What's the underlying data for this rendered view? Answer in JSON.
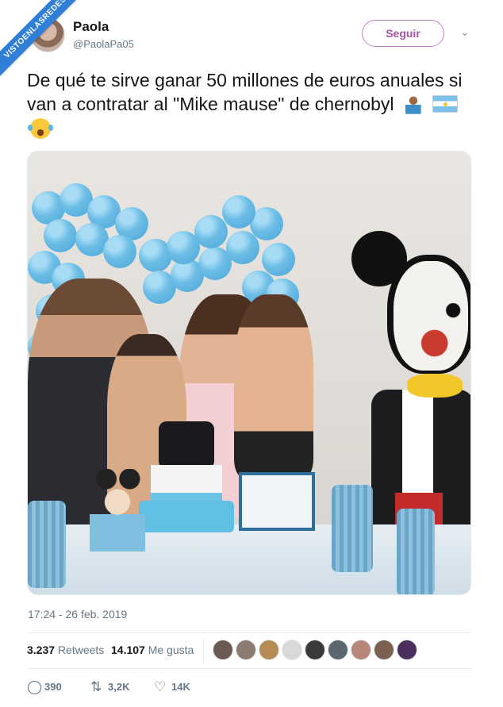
{
  "watermark": "VISTOENLASREDES",
  "author": {
    "name": "Paola",
    "handle": "@PaolaPa05"
  },
  "follow_label": "Seguir",
  "tweet_text": "De qué te sirve ganar 50 millones de euros anuales si van a contratar al \"Mike mause\" de chernobyl",
  "emojis": [
    "person-shrugging-icon",
    "argentina-flag-icon",
    "laughing-tears-icon"
  ],
  "timestamp": "17:24 - 26 feb. 2019",
  "stats": {
    "retweets_count": "3.237",
    "retweets_label": "Retweets",
    "likes_count": "14.107",
    "likes_label": "Me gusta"
  },
  "likers": [
    "#6b5a52",
    "#8c7b70",
    "#b58a55",
    "#d9d9d9",
    "#3a3a3a",
    "#5a6670",
    "#b7887a",
    "#7c6152",
    "#4a2f5c"
  ],
  "actions": {
    "reply_count": "390",
    "retweet_count": "3,2K",
    "like_count": "14K"
  },
  "colors": {
    "follow_border": "#c77ec5",
    "text_secondary": "#657786",
    "balloon": "#6cbde6"
  }
}
